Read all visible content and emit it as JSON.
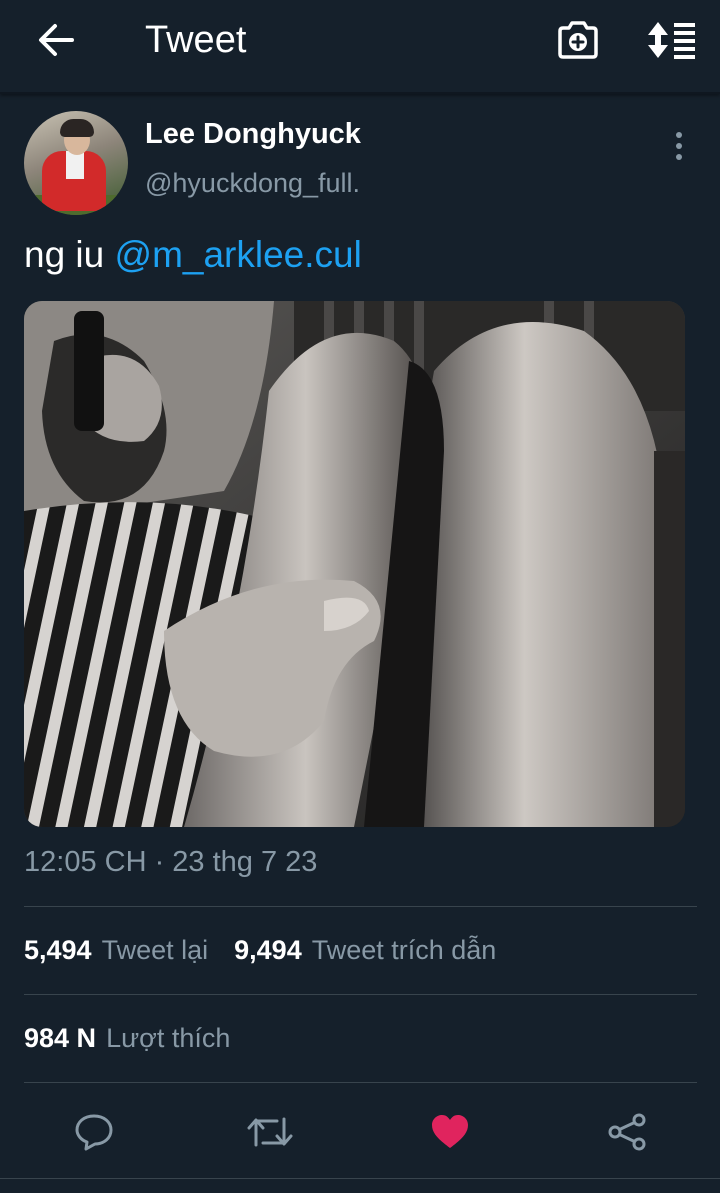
{
  "topbar": {
    "title": "Tweet",
    "back_icon": "arrow-left-icon",
    "camera_icon": "camera-plus-icon",
    "sort_icon": "sort-arrows-list-icon"
  },
  "tweet": {
    "author": {
      "display_name": "Lee Donghyuck",
      "handle": "@hyuckdong_full."
    },
    "text_prefix": "ng iu ",
    "mention": "@m_arklee.cul",
    "timestamp": "12:05 CH · 23 thg 7 23",
    "stats": {
      "retweets_count": "5,494",
      "retweets_label": "Tweet lại",
      "quotes_count": "9,494",
      "quotes_label": "Tweet trích dẫn",
      "likes_count": "984 N",
      "likes_label": "Lượt thích"
    },
    "liked": true
  },
  "colors": {
    "background": "#15202b",
    "accent": "#1da1f2",
    "muted": "#8899a6",
    "like": "#e0245e",
    "divider": "#38444d"
  }
}
